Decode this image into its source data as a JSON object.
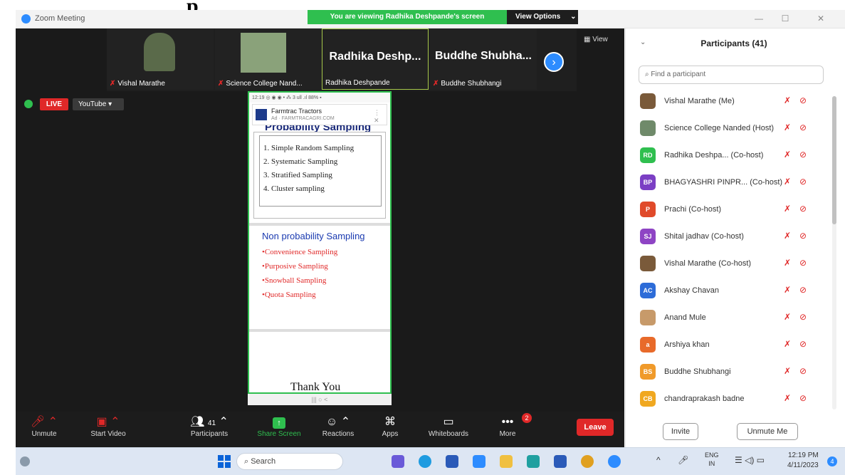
{
  "overlay_title": "p",
  "window": {
    "app_title": "Zoom Meeting",
    "banner": "You are viewing Radhika Deshpande's screen",
    "view_options": "View Options",
    "minimize": "—",
    "maximize": "☐",
    "close": "✕"
  },
  "thumbnails": [
    {
      "name": "Vishal Marathe",
      "big": ""
    },
    {
      "name": "Science College Nand...",
      "big": ""
    },
    {
      "name": "Radhika Deshpande",
      "big": "Radhika  Deshp..."
    },
    {
      "name": "Buddhe Shubhangi",
      "big": "Buddhe  Shubha..."
    }
  ],
  "view_label": "View",
  "live": {
    "badge": "LIVE",
    "platform": "YouTube ▾"
  },
  "phone": {
    "status": "12:19 ◎ ◉ ◉ •            ⁂ 3 ull .ıl 88% ▪",
    "ad_title": "Farmtrac Tractors",
    "ad_sub": "Ad · FARMTRACAGRI.COM",
    "ad_close": "⋮   ✕",
    "slide1_title": "Probability Sampling",
    "slide1_items": [
      "1. Simple Random Sampling",
      "2. Systematic Sampling",
      "3. Stratified Sampling",
      "4. Cluster sampling"
    ],
    "slide2_title": "Non probability Sampling",
    "slide2_items": [
      "•Convenience Sampling",
      "•Purposive Sampling",
      "•Snowball Sampling",
      "•Quota Sampling"
    ],
    "slide3_title": "Thank You",
    "nav": "|||              ○              <"
  },
  "toolbar": {
    "unmute": "Unmute",
    "start_video": "Start Video",
    "participants": "Participants",
    "participants_count": "41",
    "share_screen": "Share Screen",
    "reactions": "Reactions",
    "apps": "Apps",
    "whiteboards": "Whiteboards",
    "more": "More",
    "more_badge": "2",
    "leave": "Leave"
  },
  "panel": {
    "title": "Participants (41)",
    "search_placeholder": "Find a participant",
    "invite": "Invite",
    "unmute_me": "Unmute Me",
    "participants": [
      {
        "initials": "",
        "name": "Vishal Marathe (Me)",
        "color": "#7a5a3a"
      },
      {
        "initials": "",
        "name": "Science College Nanded (Host)",
        "color": "#6f8a6a"
      },
      {
        "initials": "RD",
        "name": "Radhika Deshpa...  (Co-host)",
        "color": "#2fbf4f"
      },
      {
        "initials": "BP",
        "name": "BHAGYASHRI PINPR...  (Co-host)",
        "color": "#7b3fc4"
      },
      {
        "initials": "P",
        "name": "Prachi (Co-host)",
        "color": "#e04a2a"
      },
      {
        "initials": "SJ",
        "name": "Shital jadhav (Co-host)",
        "color": "#8e44c4"
      },
      {
        "initials": "",
        "name": "Vishal Marathe (Co-host)",
        "color": "#7a5a3a"
      },
      {
        "initials": "AC",
        "name": "Akshay Chavan",
        "color": "#2d6cd8"
      },
      {
        "initials": "",
        "name": "Anand Mule",
        "color": "#c79a6a"
      },
      {
        "initials": "a",
        "name": "Arshiya khan",
        "color": "#e86a2a"
      },
      {
        "initials": "BS",
        "name": "Buddhe Shubhangi",
        "color": "#f09a2a"
      },
      {
        "initials": "CB",
        "name": "chandraprakash badne",
        "color": "#f0a820"
      }
    ]
  },
  "taskbar": {
    "search": "Search",
    "lang_top": "ENG",
    "lang_bottom": "IN",
    "time": "12:19 PM",
    "date": "4/11/2023",
    "notifications": "4"
  }
}
